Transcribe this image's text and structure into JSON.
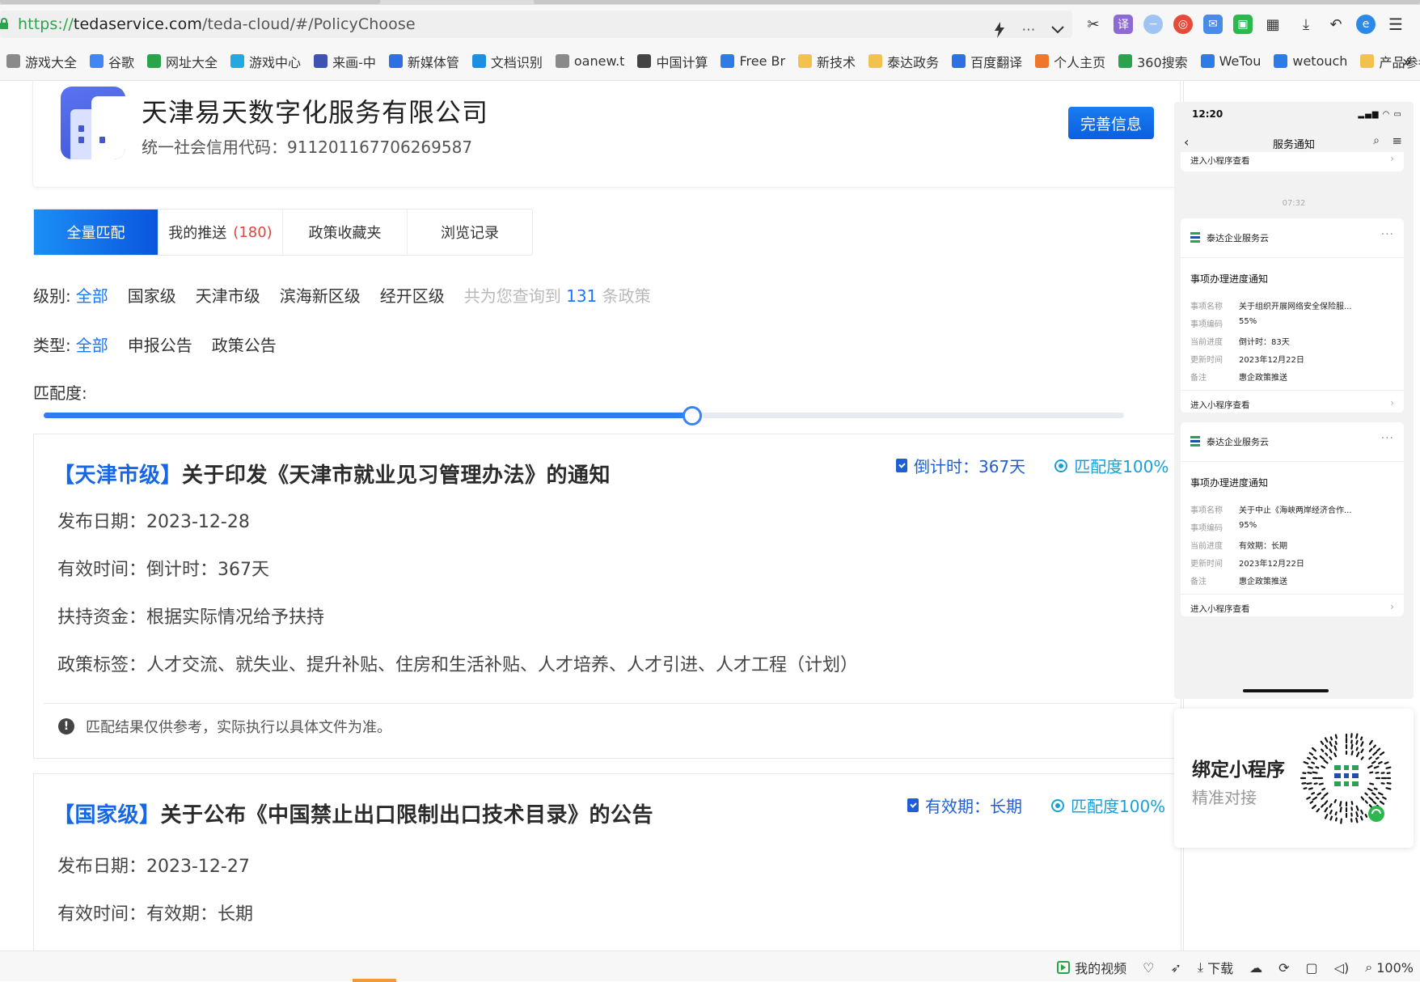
{
  "browser": {
    "url_scheme": "https://",
    "url_host": "tedaservice.com",
    "url_path": "/teda-cloud/#/PolicyChoose",
    "url_icons": [
      "lightning-icon",
      "more-icon",
      "chevron-down-icon"
    ],
    "toolbar_icons": [
      "scissors-icon",
      "translate-icon",
      "minus-icon",
      "weibo-icon",
      "mail-icon",
      "wechat-icon",
      "apps-icon",
      "download-icon",
      "undo-icon",
      "browser-logo-icon",
      "menu-icon"
    ],
    "bookmarks": [
      {
        "label": "游戏大全",
        "icon": "globe-icon",
        "color": "#8a8a8a"
      },
      {
        "label": "谷歌",
        "icon": "google-icon",
        "color": "#4285f4"
      },
      {
        "label": "网址大全",
        "icon": "star-icon",
        "color": "#2aa44a"
      },
      {
        "label": "游戏中心",
        "icon": "game-icon",
        "color": "#23a8e0"
      },
      {
        "label": "来画-中",
        "icon": "laihua-icon",
        "color": "#3f51b5"
      },
      {
        "label": "新媒体管",
        "icon": "p-icon",
        "color": "#2f6fe4"
      },
      {
        "label": "文档识别",
        "icon": "cc-icon",
        "color": "#1d8fe1"
      },
      {
        "label": "oanew.t",
        "icon": "globe-icon",
        "color": "#8a8a8a"
      },
      {
        "label": "中国计算",
        "icon": "eye-icon",
        "color": "#444"
      },
      {
        "label": "Free Br",
        "icon": "v-icon",
        "color": "#2d7be5"
      },
      {
        "label": "新技术",
        "icon": "folder-icon",
        "color": "#f2c14e"
      },
      {
        "label": "泰达政务",
        "icon": "folder-icon",
        "color": "#f2c14e"
      },
      {
        "label": "百度翻译",
        "icon": "translate-icon",
        "color": "#2f6fe4"
      },
      {
        "label": "个人主页",
        "icon": "k-icon",
        "color": "#f0772a"
      },
      {
        "label": "360搜索",
        "icon": "search-360-icon",
        "color": "#2aa44a"
      },
      {
        "label": "WeTou",
        "icon": "wetouch-icon",
        "color": "#2d7be5"
      },
      {
        "label": "wetouch",
        "icon": "wetouch-icon",
        "color": "#2d7be5"
      },
      {
        "label": "产品参考",
        "icon": "folder-icon",
        "color": "#f2c14e"
      }
    ],
    "more_label": "»"
  },
  "company": {
    "name": "天津易天数字化服务有限公司",
    "credit_code": "统一社会信用代码：911201167706269587",
    "complete_button": "完善信息"
  },
  "tabs": [
    {
      "label": "全量匹配",
      "count": "",
      "active": true
    },
    {
      "label": "我的推送",
      "count": "(180)",
      "active": false
    },
    {
      "label": "政策收藏夹",
      "count": "",
      "active": false
    },
    {
      "label": "浏览记录",
      "count": "",
      "active": false
    }
  ],
  "filters": {
    "level": {
      "label": "级别:",
      "options": [
        "全部",
        "国家级",
        "天津市级",
        "滨海新区级",
        "经开区级"
      ],
      "result_prefix": "共为您查询到",
      "result_count": "131",
      "result_suffix": "条政策"
    },
    "type": {
      "label": "类型:",
      "options": [
        "全部",
        "申报公告",
        "政策公告"
      ]
    },
    "match_label": "匹配度:",
    "match_value_fraction": 0.6
  },
  "policies": [
    {
      "level": "【天津市级】",
      "title": "关于印发《天津市就业见习管理办法》的通知",
      "countdown": "倒计时：367天",
      "match": "匹配度100%",
      "publish_date": "发布日期：2023-12-28",
      "valid_time": "有效时间：倒计时：367天",
      "funding": "扶持资金：根据实际情况给予扶持",
      "tags": "政策标签：人才交流、就失业、提升补贴、住房和生活补贴、人才培养、人才引进、人才工程（计划）",
      "disclaimer": "匹配结果仅供参考，实际执行以具体文件为准。"
    },
    {
      "level": "【国家级】",
      "title": "关于公布《中国禁止出口限制出口技术目录》的公告",
      "countdown": "有效期：长期",
      "match": "匹配度100%",
      "publish_date": "发布日期：2023-12-27",
      "valid_time": "有效时间：有效期：长期"
    }
  ],
  "phone": {
    "time": "12:20",
    "signal": "▂▄▆ ◠ ▭",
    "title": "服务通知",
    "top_link": "进入小程序查看",
    "timestamp": "07:32",
    "cards": [
      {
        "sender": "泰达企业服务云",
        "notice_title": "事项办理进度通知",
        "rows": [
          {
            "k": "事项名称",
            "v": "关于组织开展网络安全保险服..."
          },
          {
            "k": "事项编码",
            "v": "55%"
          },
          {
            "k": "当前进度",
            "v": "倒计时：83天"
          },
          {
            "k": "更新时间",
            "v": "2023年12月22日"
          },
          {
            "k": "备注",
            "v": "惠企政策推送"
          }
        ],
        "link": "进入小程序查看"
      },
      {
        "sender": "泰达企业服务云",
        "notice_title": "事项办理进度通知",
        "rows": [
          {
            "k": "事项名称",
            "v": "关于中止《海峡两岸经济合作..."
          },
          {
            "k": "事项编码",
            "v": "95%"
          },
          {
            "k": "当前进度",
            "v": "有效期：长期"
          },
          {
            "k": "更新时间",
            "v": "2023年12月22日"
          },
          {
            "k": "备注",
            "v": "惠企政策推送"
          }
        ],
        "link": "进入小程序查看"
      }
    ]
  },
  "mini_program": {
    "title": "绑定小程序",
    "subtitle": "精准对接"
  },
  "statusbar": {
    "video": "我的视频",
    "download": "下载",
    "zoom": "100%"
  },
  "colors": {
    "accent": "#1677ff",
    "tab_active": "#0a56de",
    "count_red": "#e0443e",
    "match_cyan": "#18a0d8"
  }
}
